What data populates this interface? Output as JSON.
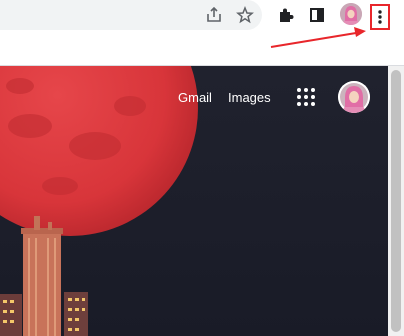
{
  "toolbar": {
    "icons": [
      "share-icon",
      "star-icon",
      "extensions-icon",
      "side-panel-icon",
      "profile-avatar",
      "more-vert-icon"
    ]
  },
  "google_header": {
    "gmail_label": "Gmail",
    "images_label": "Images"
  },
  "colors": {
    "annotation": "#e8262b",
    "moon": "#d8353a",
    "night_sky": "#1a1d2a"
  }
}
